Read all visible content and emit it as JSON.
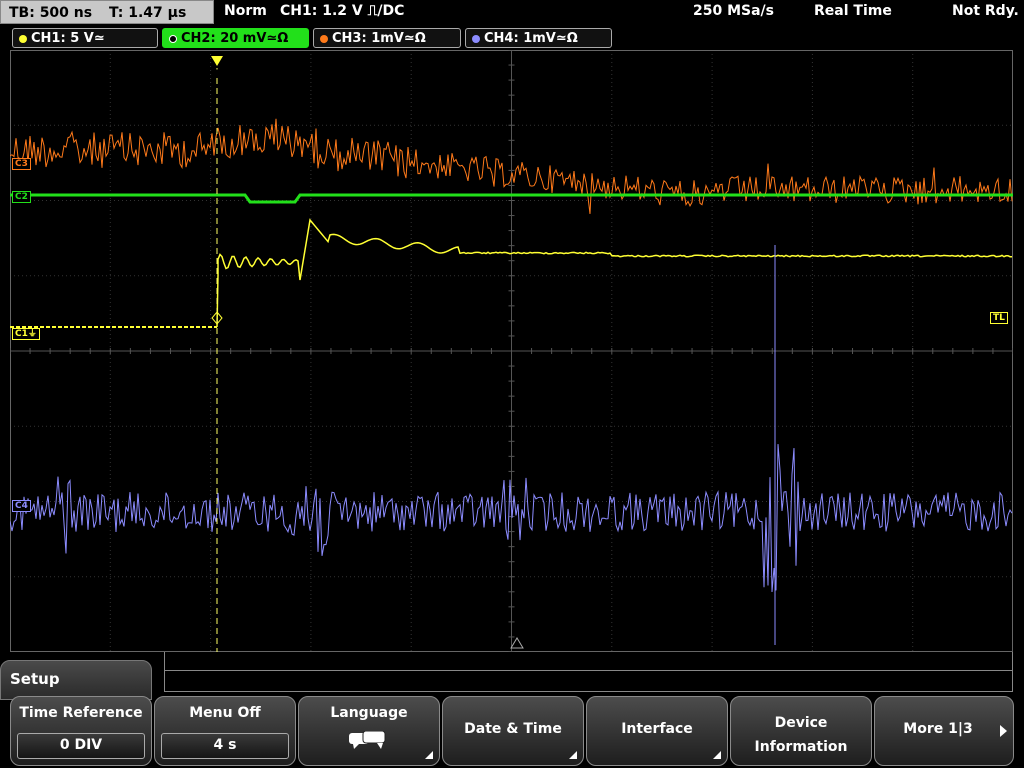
{
  "header": {
    "timebase": "TB: 500 ns",
    "trigger_time": "T: 1.47 µs",
    "mode": "Norm",
    "trigger_setting": "CH1: 1.2 V ⎍/DC",
    "sample_rate": "250 MSa/s",
    "acq_mode": "Real Time",
    "state": "Not Rdy."
  },
  "channels": [
    {
      "label": "CH1: 5 V≃",
      "color": "#ffff33"
    },
    {
      "label": "CH2: 20 mV≃Ω",
      "color": "#22e01a"
    },
    {
      "label": "CH3: 1mV≃Ω",
      "color": "#ff7a1a"
    },
    {
      "label": "CH4: 1mV≃Ω",
      "color": "#8c8cff"
    }
  ],
  "markers": {
    "trigger_level": "TL",
    "ch1": "C1",
    "ch2": "C2",
    "ch3": "C3",
    "ch4": "C4"
  },
  "menu": {
    "title": "Setup",
    "softkeys": [
      {
        "label": "Time Reference",
        "value": "0 DIV"
      },
      {
        "label": "Menu Off",
        "value": "4 s"
      },
      {
        "label": "Language",
        "icon": "speech-bubble-icon"
      },
      {
        "label": "Date & Time"
      },
      {
        "label": "Interface"
      },
      {
        "label_line1": "Device",
        "label_line2": "Information"
      },
      {
        "label": "More 1|3"
      }
    ]
  }
}
